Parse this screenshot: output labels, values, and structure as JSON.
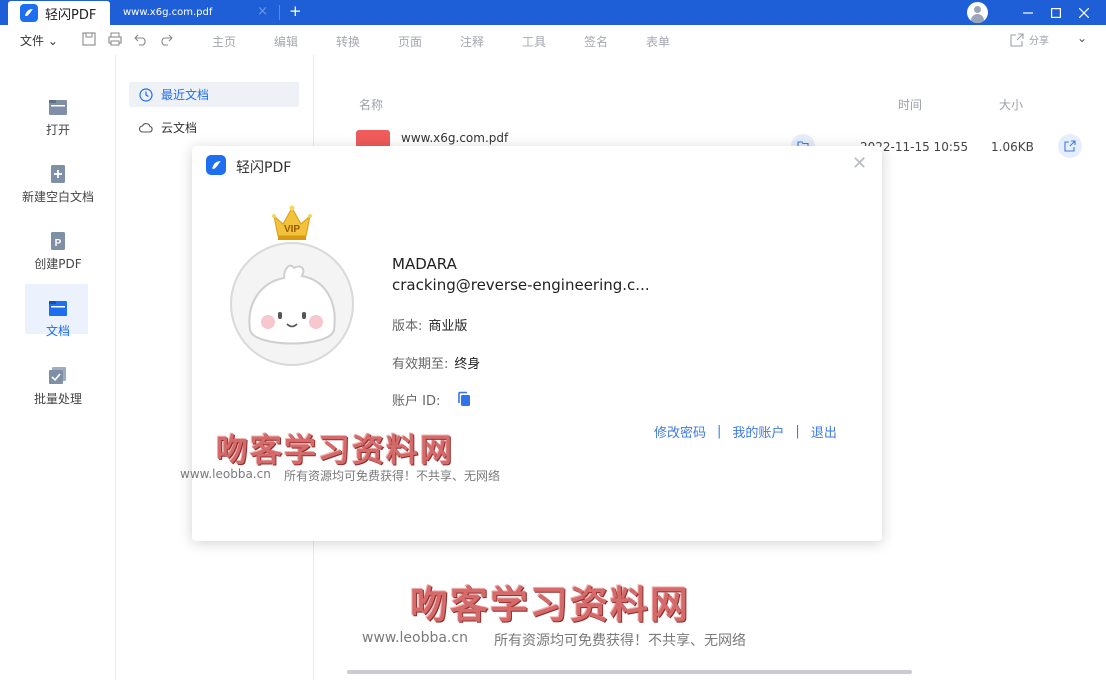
{
  "titlebar": {
    "app_name": "轻闪PDF",
    "doc_tab": "www.x6g.com.pdf",
    "close_tab": "×",
    "new_tab": "+",
    "min": "—",
    "max": "☐",
    "close": "✕"
  },
  "menubar": {
    "file": "文件 ⌄",
    "items": [
      "主页",
      "编辑",
      "转换",
      "页面",
      "注释",
      "工具",
      "签名",
      "表单"
    ],
    "share": "分享",
    "collapse": "⌄"
  },
  "sidebar": {
    "items": [
      {
        "label": "打开"
      },
      {
        "label": "新建空白文档"
      },
      {
        "label": "创建PDF"
      },
      {
        "label": "文档"
      },
      {
        "label": "批量处理"
      }
    ]
  },
  "nav": {
    "recent": "最近文档",
    "cloud": "云文档"
  },
  "filelist": {
    "headers": {
      "name": "名称",
      "time": "时间",
      "size": "大小"
    },
    "rows": [
      {
        "name": "www.x6g.com.pdf",
        "time": "2022-11-15 10:55",
        "size": "1.06KB"
      }
    ]
  },
  "dialog": {
    "title": "轻闪PDF",
    "close": "✕",
    "vip_badge": "VIP",
    "user_name": "MADARA",
    "user_email": "cracking@reverse-engineering.c...",
    "edition_label": "版本:",
    "edition_value": "商业版",
    "expiry_label": "有效期至:",
    "expiry_value": "终身",
    "account_id_label": "账户 ID:",
    "links": {
      "change_password": "修改密码",
      "my_account": "我的账户",
      "logout": "退出",
      "sep": "|"
    }
  },
  "watermarks": [
    {
      "title": "吻客学习资料网",
      "url": "www.leobba.cn",
      "slogan": "所有资源均可免费获得！不共享、无网络"
    },
    {
      "title": "吻客学习资料网",
      "url": "www.leobba.cn",
      "slogan": "所有资源均可免费获得！不共享、无网络"
    }
  ],
  "colors": {
    "titlebar": "#1e5fd8",
    "accent": "#1e6ef0",
    "link": "#3d7ae6",
    "watermark": "#d46a6a"
  },
  "icons": {
    "open": "folder-icon",
    "new": "new-doc-icon",
    "create": "create-pdf-icon",
    "docs": "documents-icon",
    "batch": "batch-icon",
    "recent": "clock-icon",
    "cloud": "cloud-icon",
    "copy": "copy-icon"
  }
}
